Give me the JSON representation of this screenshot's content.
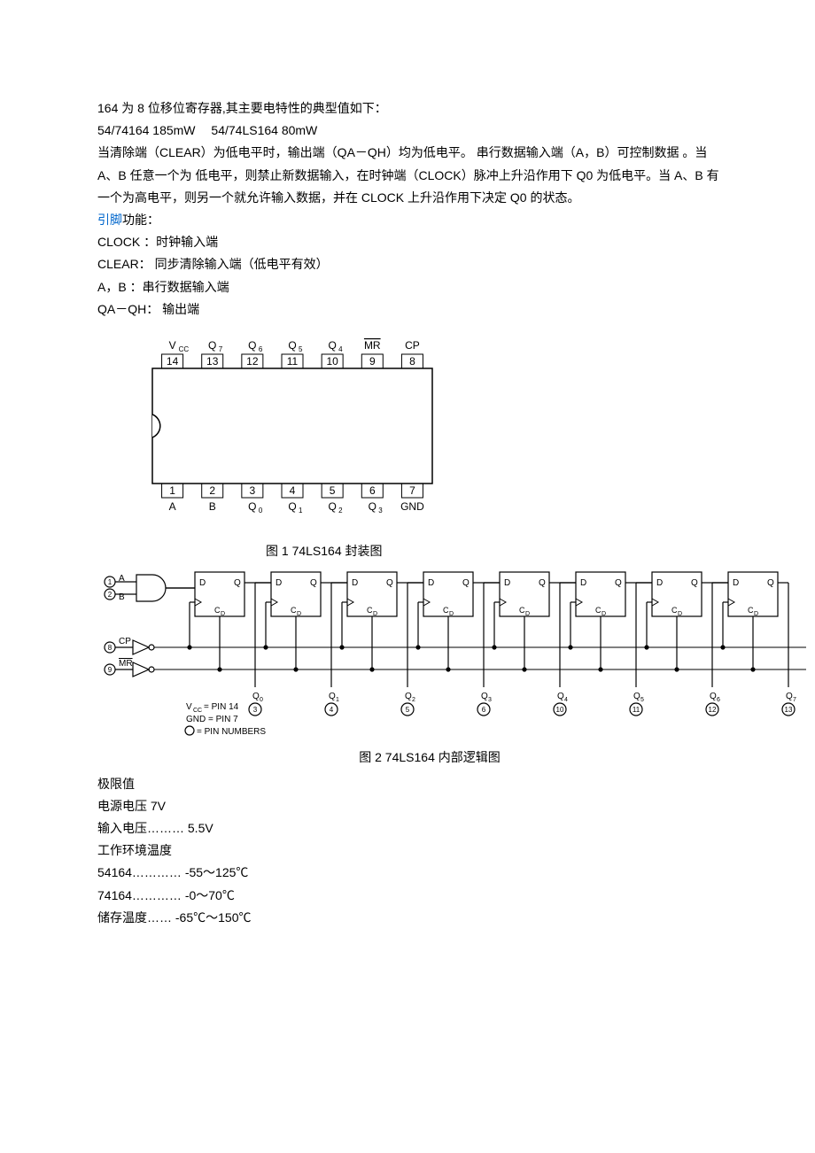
{
  "intro": {
    "line1": "164 为 8 位移位寄存器,其主要电特性的典型值如下：",
    "line2": " 54/74164  185mW  54/74LS164 80mW",
    "line3": "当清除端（CLEAR）为低电平时，输出端（QA－QH）均为低电平。 串行数据输入端（A，B）可控制数据 。当 A、B 任意一个为 低电平，则禁止新数据输入，在时钟端（CLOCK）脉冲上升沿作用下 Q0 为低电平。当 A、B 有一个为高电平，则另一个就允许输入数据，并在 CLOCK 上升沿作用下决定 Q0 的状态。"
  },
  "pins": {
    "heading_link": "引脚",
    "heading_rest": "功能：",
    "clock": "CLOCK ：时钟输入端",
    "clear": "CLEAR：  同步清除输入端（低电平有效）",
    "ab": "A，B ：串行数据输入端",
    "q": "QA－QH：  输出端"
  },
  "fig1_caption": "图 1 74LS164 封装图",
  "fig1": {
    "top_labels": [
      "V",
      "Q",
      "Q",
      "Q",
      "Q",
      "MR",
      "CP"
    ],
    "top_sub": [
      "CC",
      "7",
      "6",
      "5",
      "4",
      "",
      ""
    ],
    "top_pins": [
      "14",
      "13",
      "12",
      "11",
      "10",
      "9",
      "8"
    ],
    "bot_pins": [
      "1",
      "2",
      "3",
      "4",
      "5",
      "6",
      "7"
    ],
    "bot_labels": [
      "A",
      "B",
      "Q",
      "Q",
      "Q",
      "Q",
      "GND"
    ],
    "bot_sub": [
      "",
      "",
      "0",
      "1",
      "2",
      "3",
      ""
    ]
  },
  "fig2_caption": "图 2 74LS164 内部逻辑图",
  "fig2": {
    "inputs": {
      "a": "A",
      "b": "B",
      "cp": "CP",
      "mr": "MR"
    },
    "pin_a": "1",
    "pin_b": "2",
    "pin_cp": "8",
    "pin_mr": "9",
    "ff": {
      "d": "D",
      "q": "Q",
      "cd": "C"
    },
    "outs": [
      "Q",
      "Q",
      "Q",
      "Q",
      "Q",
      "Q",
      "Q",
      "Q"
    ],
    "outs_sub": [
      "0",
      "1",
      "2",
      "3",
      "4",
      "5",
      "6",
      "7"
    ],
    "out_pins": [
      "3",
      "4",
      "5",
      "6",
      "10",
      "11",
      "12",
      "13"
    ],
    "note1": "V",
    "note1b": " = PIN 14",
    "note1sub": "CC",
    "note2": "GND = PIN 7",
    "note3": " = PIN NUMBERS"
  },
  "limits": {
    "title": "极限值",
    "v_supply": "电源电压 7V",
    "v_in": "输入电压……… 5.5V",
    "temp_op": "工作环境温度",
    "t54": "54164………… -55～125℃",
    "t74": "74164………… -0～70℃",
    "t_store": "储存温度……  -65℃～150℃"
  }
}
